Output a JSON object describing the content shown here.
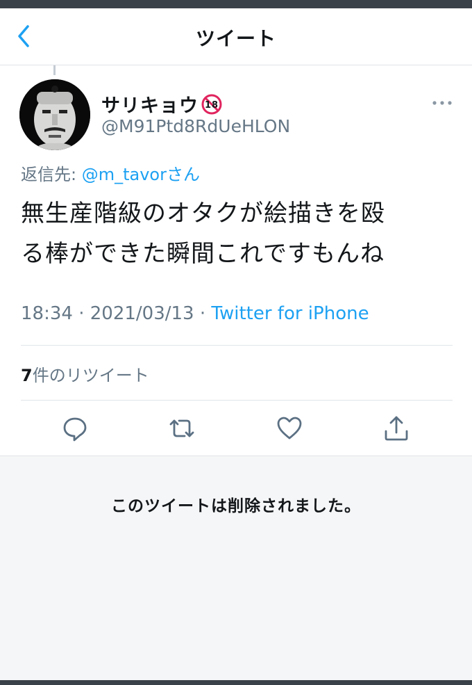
{
  "header": {
    "title": "ツイート",
    "back_icon": "chevron-left-icon",
    "accent_color": "#1da1f2"
  },
  "tweet": {
    "display_name": "サリキョウ",
    "badge_icon": "r18-badge-icon",
    "handle": "@M91Ptd8RdUeHLON",
    "reply_prefix": "返信先: ",
    "reply_mention": "@m_tavor",
    "reply_suffix": "さん",
    "text_line1": "無生産階級のオタクが絵描きを殴",
    "text_line2": "る棒ができた瞬間これですもんね",
    "time": "18:34",
    "date": "2021/03/13",
    "source": "Twitter for iPhone",
    "retweet_count": "7",
    "retweet_label": "件のリツイート"
  },
  "actions": [
    {
      "name": "reply",
      "icon": "reply-icon"
    },
    {
      "name": "retweet",
      "icon": "retweet-icon"
    },
    {
      "name": "like",
      "icon": "heart-icon"
    },
    {
      "name": "share",
      "icon": "share-icon"
    }
  ],
  "deleted_notice": "このツイートは削除されました。"
}
